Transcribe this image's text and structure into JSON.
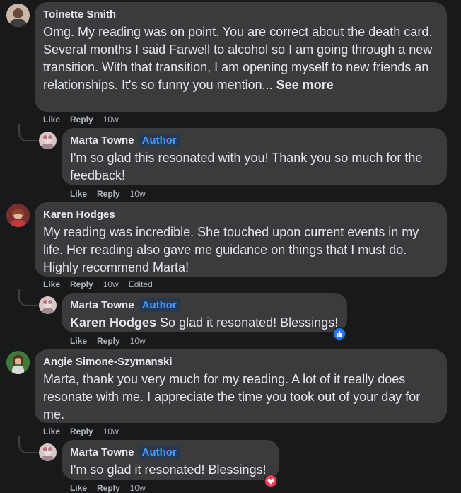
{
  "comments": [
    {
      "name": "Toinette Smith",
      "text": "Omg. My reading was on point. You are correct about the death card. Several months I said Farwell to alcohol so I am going through a new transition. With that transition, I am opening myself to new friends an relationships. It's so funny you mention...",
      "see_more": "See more",
      "like": "Like",
      "reply": "Reply",
      "time": "10w",
      "reply_comment": {
        "name": "Marta Towne",
        "badge": "Author",
        "text": "I'm so glad this resonated with you! Thank you so much for the feedback!",
        "like": "Like",
        "reply": "Reply",
        "time": "10w"
      }
    },
    {
      "name": "Karen Hodges",
      "text": "My reading was incredible. She touched upon current events in my life. Her reading also gave me guidance on things that I must do. Highly recommend Marta!",
      "like": "Like",
      "reply": "Reply",
      "time": "10w",
      "edited": "Edited",
      "reply_comment": {
        "name": "Marta Towne",
        "badge": "Author",
        "mention": "Karen Hodges",
        "text": "So glad it resonated! Blessings!",
        "like": "Like",
        "reply": "Reply",
        "time": "10w",
        "reaction": "like-reaction-icon"
      }
    },
    {
      "name": "Angie Simone-Szymanski",
      "text": "Marta, thank you very much for my reading. A lot of it really does resonate with me. I appreciate the time you took out of your day for me.",
      "like": "Like",
      "reply": "Reply",
      "time": "10w",
      "reply_comment": {
        "name": "Marta Towne",
        "badge": "Author",
        "text": "I'm so glad it resonated! Blessings!",
        "like": "Like",
        "reply": "Reply",
        "time": "10w",
        "reaction": "love-reaction-icon"
      }
    }
  ],
  "colors": {
    "background": "#18191a",
    "bubble": "#3a3b3c",
    "text": "#e4e6eb",
    "secondary": "#b0b3b8",
    "author_badge_bg": "#263951",
    "author_badge_text": "#4599ff",
    "like_blue": "#2078f4",
    "love_red": "#f33e58"
  }
}
